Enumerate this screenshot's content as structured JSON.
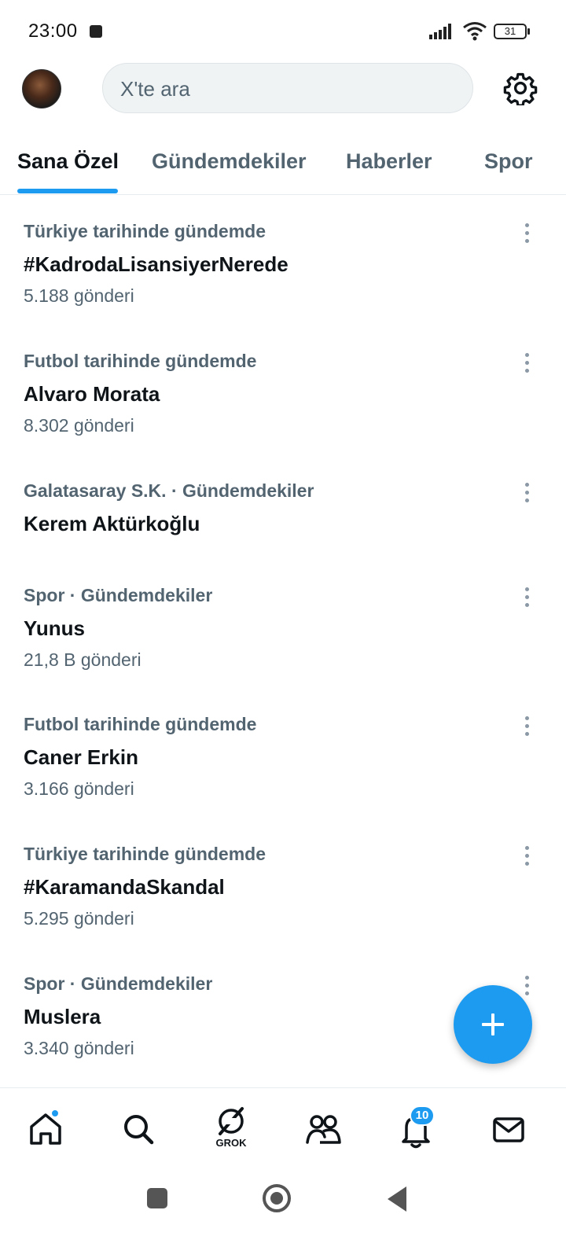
{
  "status_bar": {
    "time": "23:00",
    "battery": "31"
  },
  "header": {
    "search_placeholder": "X'te ara",
    "avatar_icon": "profile-avatar",
    "settings_icon": "gear-icon"
  },
  "tabs": [
    {
      "label": "Sana Özel",
      "active": true
    },
    {
      "label": "Gündemdekiler",
      "active": false
    },
    {
      "label": "Haberler",
      "active": false
    },
    {
      "label": "Spor",
      "active": false
    }
  ],
  "trends": [
    {
      "context": "Türkiye tarihinde gündemde",
      "title": "#KadrodaLisansiyerNerede",
      "count": "5.188 gönderi"
    },
    {
      "context": "Futbol tarihinde gündemde",
      "title": "Alvaro Morata",
      "count": "8.302 gönderi"
    },
    {
      "context": "Galatasaray S.K. · Gündemdekiler",
      "title": "Kerem Aktürkoğlu",
      "count": ""
    },
    {
      "context": "Spor · Gündemdekiler",
      "title": "Yunus",
      "count": "21,8 B gönderi"
    },
    {
      "context": "Futbol tarihinde gündemde",
      "title": "Caner Erkin",
      "count": "3.166 gönderi"
    },
    {
      "context": "Türkiye tarihinde gündemde",
      "title": "#KaramandaSkandal",
      "count": "5.295 gönderi"
    },
    {
      "context": "Spor · Gündemdekiler",
      "title": "Muslera",
      "count": "3.340 gönderi"
    }
  ],
  "bottom_nav": {
    "grok_label": "GROK",
    "notification_count": "10",
    "items": [
      "home-icon",
      "search-icon",
      "grok-icon",
      "communities-icon",
      "bell-icon",
      "mail-icon"
    ]
  },
  "colors": {
    "accent": "#1d9bf0",
    "secondary_text": "#536471",
    "primary_text": "#0f1419"
  }
}
